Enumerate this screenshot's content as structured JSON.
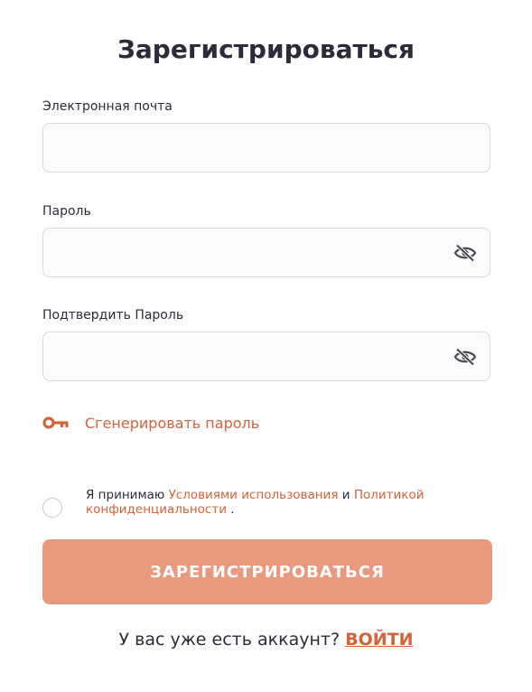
{
  "form": {
    "title": "Зарегистрироваться",
    "email": {
      "label": "Электронная почта",
      "value": "",
      "placeholder": ""
    },
    "password": {
      "label": "Пароль",
      "value": "",
      "placeholder": ""
    },
    "confirm_password": {
      "label": "Подтвердить Пароль",
      "value": "",
      "placeholder": ""
    },
    "generate_password_label": "Сгенерировать пароль",
    "terms": {
      "prefix": "Я принимаю",
      "terms_link": "Условиями использования",
      "conjunction": "и",
      "privacy_link": "Политикой конфиденциальности",
      "suffix": ".",
      "checked": false
    },
    "submit_label": "ЗАРЕГИСТРИРОВАТЬСЯ",
    "footer": {
      "question": "У вас уже есть аккаунт?",
      "login_link": "ВОЙТИ"
    }
  },
  "colors": {
    "accent": "#d4633a",
    "button": "#e99a7e",
    "text": "#2b2b3c",
    "border": "#d9d9de"
  },
  "icons": {
    "password_toggle": "eye-slash-icon",
    "generate": "key-icon"
  }
}
